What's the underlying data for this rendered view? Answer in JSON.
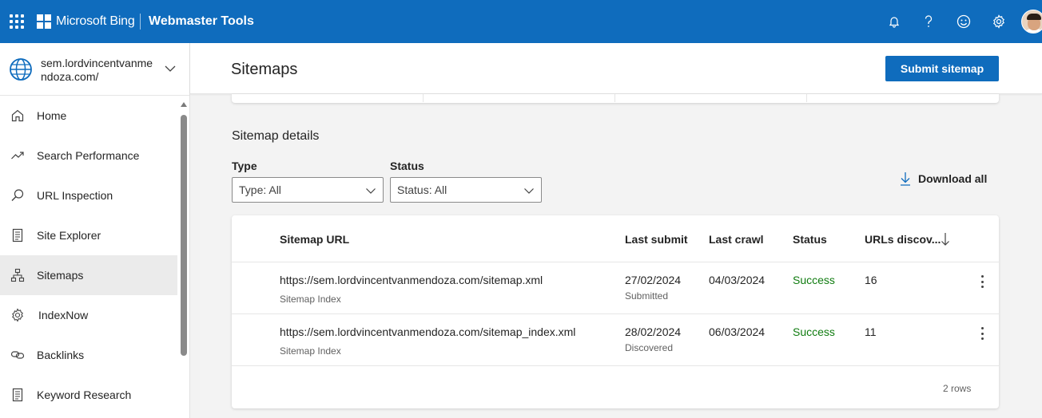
{
  "header": {
    "brand": "Microsoft Bing",
    "product": "Webmaster Tools",
    "icons": [
      "waffle-icon",
      "bell-icon",
      "help-icon",
      "smiley-icon",
      "gear-icon"
    ],
    "accent": "#0f6cbd"
  },
  "sidebar": {
    "site": "sem.lordvincentvanmendoza.com/",
    "items": [
      {
        "label": "Home",
        "icon": "home-icon"
      },
      {
        "label": "Search Performance",
        "icon": "trend-icon"
      },
      {
        "label": "URL Inspection",
        "icon": "search-icon"
      },
      {
        "label": "Site Explorer",
        "icon": "document-icon"
      },
      {
        "label": "Sitemaps",
        "icon": "sitemap-icon",
        "active": true
      },
      {
        "label": "IndexNow",
        "icon": "gear-icon"
      },
      {
        "label": "Backlinks",
        "icon": "link-icon"
      },
      {
        "label": "Keyword Research",
        "icon": "document-icon"
      }
    ]
  },
  "page": {
    "title": "Sitemaps",
    "submit_label": "Submit sitemap"
  },
  "details": {
    "title": "Sitemap details",
    "type_label": "Type",
    "type_value": "Type: All",
    "status_label": "Status",
    "status_value": "Status: All",
    "download_label": "Download all"
  },
  "table": {
    "columns": [
      "Sitemap URL",
      "Last submit",
      "Last crawl",
      "Status",
      "URLs discov..."
    ],
    "rows": [
      {
        "url": "https://sem.lordvincentvanmendoza.com/sitemap.xml",
        "kind": "Sitemap Index",
        "last_submit": "27/02/2024",
        "submit_note": "Submitted",
        "last_crawl": "04/03/2024",
        "status": "Success",
        "urls": "16"
      },
      {
        "url": "https://sem.lordvincentvanmendoza.com/sitemap_index.xml",
        "kind": "Sitemap Index",
        "last_submit": "28/02/2024",
        "submit_note": "Discovered",
        "last_crawl": "06/03/2024",
        "status": "Success",
        "urls": "11"
      }
    ],
    "row_count": "2 rows",
    "status_color": "#107c10"
  }
}
